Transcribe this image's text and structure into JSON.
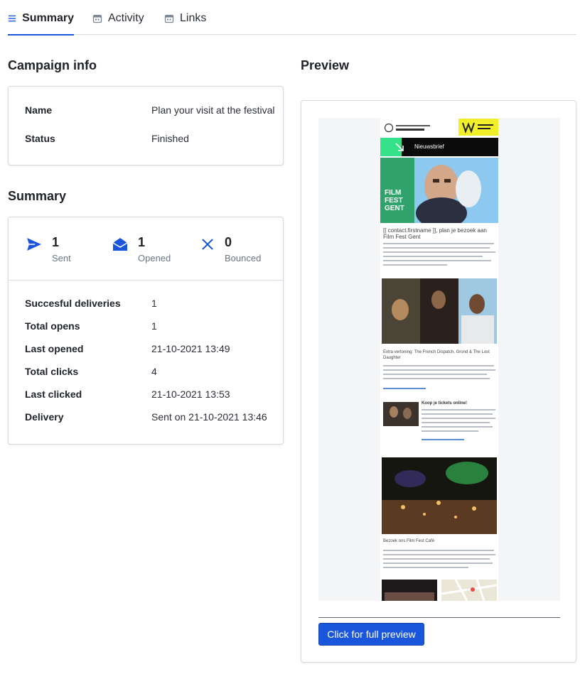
{
  "tabs": [
    {
      "label": "Summary",
      "icon": "list-icon",
      "active": true
    },
    {
      "label": "Activity",
      "icon": "calendar-icon",
      "active": false
    },
    {
      "label": "Links",
      "icon": "calendar-icon",
      "active": false
    }
  ],
  "campaign_info": {
    "title": "Campaign info",
    "rows": [
      {
        "key": "Name",
        "value": "Plan your visit at the festival"
      },
      {
        "key": "Status",
        "value": "Finished"
      }
    ]
  },
  "summary": {
    "title": "Summary",
    "stats": [
      {
        "value": "1",
        "label": "Sent",
        "icon": "send-icon"
      },
      {
        "value": "1",
        "label": "Opened",
        "icon": "opened-envelope-icon"
      },
      {
        "value": "0",
        "label": "Bounced",
        "icon": "close-icon"
      }
    ],
    "rows": [
      {
        "key": "Succesful deliveries",
        "value": "1"
      },
      {
        "key": "Total opens",
        "value": "1"
      },
      {
        "key": "Last opened",
        "value": "21-10-2021 13:49"
      },
      {
        "key": "Total clicks",
        "value": "4"
      },
      {
        "key": "Last clicked",
        "value": "21-10-2021 13:53"
      },
      {
        "key": "Delivery",
        "value": "Sent on 21-10-2021 13:46"
      }
    ]
  },
  "preview": {
    "title": "Preview",
    "button_label": "Click for full preview",
    "newsletter": {
      "header_label": "Nieuwsbrief",
      "poster_text": "FILM FEST GENT",
      "heading_1": "[[ contact.firstname ]], plan je bezoek aan Film Fest Gent",
      "heading_2": "Extra vertoning: The French Dispatch, Grond & The Lost Daughter",
      "heading_3": "Koop je tickets online!",
      "heading_4": "Bezoek ons Film Fest Café"
    }
  },
  "colors": {
    "accent": "#1a56db",
    "border": "#d6dbe1",
    "muted_text": "#6b7685"
  }
}
